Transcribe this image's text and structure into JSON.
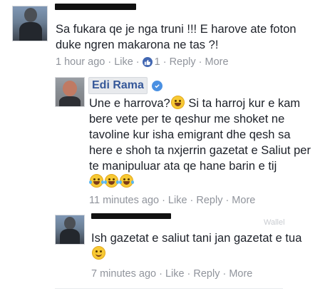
{
  "comments": [
    {
      "text": "Sa fukara qe je nga truni !!! E harove ate foton duke ngren makarona ne tas ?!",
      "time": "1 hour ago",
      "like": "Like",
      "like_count": "1",
      "reply": "Reply",
      "more": "More"
    }
  ],
  "reply_main": {
    "author": "Edi Rama",
    "text_before_emoji": "Une e harrova?",
    "text_after_emoji": " Si ta harroj kur e kam bere vete per te qeshur me shoket ne tavoline kur isha emigrant dhe qesh sa here e shoh ta nxjerrin gazetat e Saliut per te manipuluar ata qe hane barin e tij",
    "time": "11 minutes ago",
    "like": "Like",
    "reply": "Reply",
    "more": "More"
  },
  "reply_second": {
    "author_partial": "Wallel",
    "text": "Ish gazetat e saliut tani jan gazetat e tua",
    "time": "7 minutes ago",
    "like": "Like",
    "reply": "Reply",
    "more": "More"
  },
  "colors": {
    "link": "#365899",
    "meta": "#90949c",
    "like_blue": "#4267b2",
    "verified": "#4a90e2"
  }
}
